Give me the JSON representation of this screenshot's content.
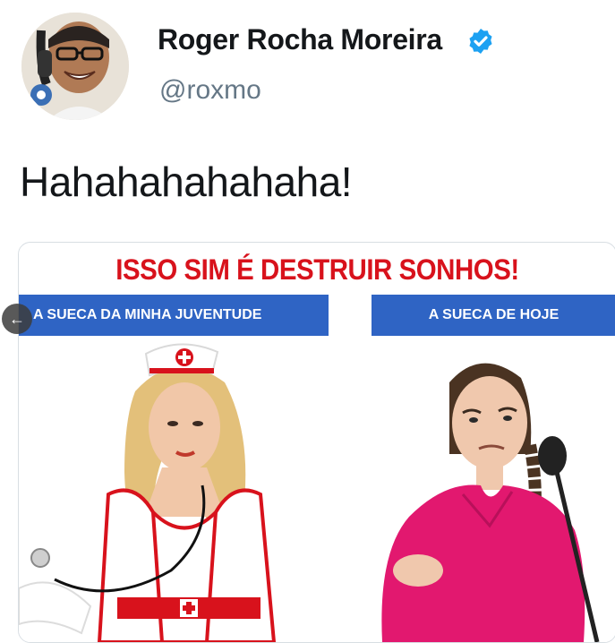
{
  "profile": {
    "display_name": "Roger Rocha Moreira",
    "handle": "@roxmo",
    "verified": true,
    "avatar_icon": "profile-photo"
  },
  "tweet": {
    "text": "Hahahahahahaha!"
  },
  "media": {
    "headline": "ISSO SIM É DESTRUIR SONHOS!",
    "left_caption": "A SUECA DA MINHA JUVENTUDE",
    "right_caption": "A SUECA DE HOJE",
    "left_image": "nurse-costume-woman",
    "right_image": "girl-in-pink-at-microphone"
  },
  "controls": {
    "back_icon": "←"
  },
  "colors": {
    "headline_red": "#d8121c",
    "banner_blue": "#2f64c4",
    "verified_blue": "#1da1f2",
    "handle_gray": "#657786"
  }
}
